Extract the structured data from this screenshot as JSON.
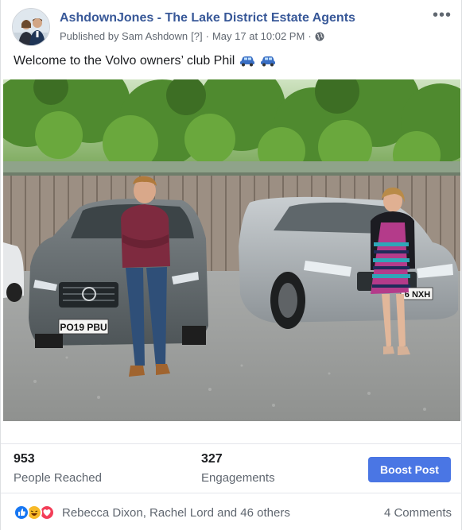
{
  "post": {
    "page_name": "AshdownJones - The Lake District Estate Agents",
    "published_by": "Published by Sam Ashdown",
    "help_marker": "[?]",
    "separator": "·",
    "timestamp": "May 17 at 10:02 PM",
    "privacy_icon": "globe-icon",
    "more_icon": "more-options-icon",
    "more_label": "•••",
    "text": "Welcome to the Volvo owners’ club Phil",
    "emoji": [
      "car-emoji",
      "car-emoji"
    ],
    "photo": {
      "plate_left": "PO19 PBU",
      "plate_right": "6 NXH"
    }
  },
  "stats": {
    "reached_value": "953",
    "reached_label": "People Reached",
    "engagements_value": "327",
    "engagements_label": "Engagements",
    "boost_label": "Boost Post"
  },
  "reactions": {
    "icons": [
      "like-icon",
      "haha-icon",
      "love-icon"
    ],
    "names": "Rebecca Dixon, Rachel Lord and 46 others",
    "comments": "4 Comments"
  },
  "colors": {
    "link_blue": "#385898",
    "button_blue": "#4a76e4",
    "like_blue": "#1877f2",
    "haha_yellow": "#f7b928",
    "love_red": "#f33e58",
    "meta_gray": "#606770"
  }
}
